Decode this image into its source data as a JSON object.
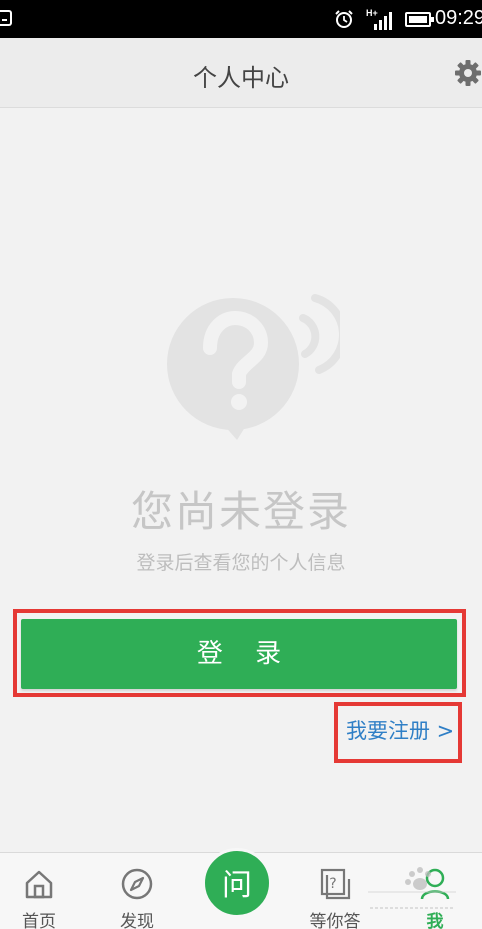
{
  "status_bar": {
    "time": "09:29",
    "signal_label": "H+",
    "icons": [
      "app-notification-icon",
      "alarm-icon",
      "signal-icon",
      "battery-icon"
    ]
  },
  "header": {
    "title": "个人中心",
    "settings_icon": "gear-icon"
  },
  "empty_state": {
    "icon": "question-bubble-icon",
    "title": "您尚未登录",
    "subtitle": "登录后查看您的个人信息"
  },
  "actions": {
    "login_label": "登 录",
    "register_label": "我要注册 >"
  },
  "bottom_nav": {
    "items": [
      {
        "label": "首页",
        "icon": "home-icon"
      },
      {
        "label": "发现",
        "icon": "compass-icon"
      },
      {
        "label": "问",
        "icon": "ask-icon"
      },
      {
        "label": "等你答",
        "icon": "question-doc-icon"
      },
      {
        "label": "我",
        "icon": "person-icon",
        "active": true
      }
    ]
  },
  "colors": {
    "accent": "#2fae56",
    "link": "#2f7fc6",
    "highlight": "#e53935"
  }
}
